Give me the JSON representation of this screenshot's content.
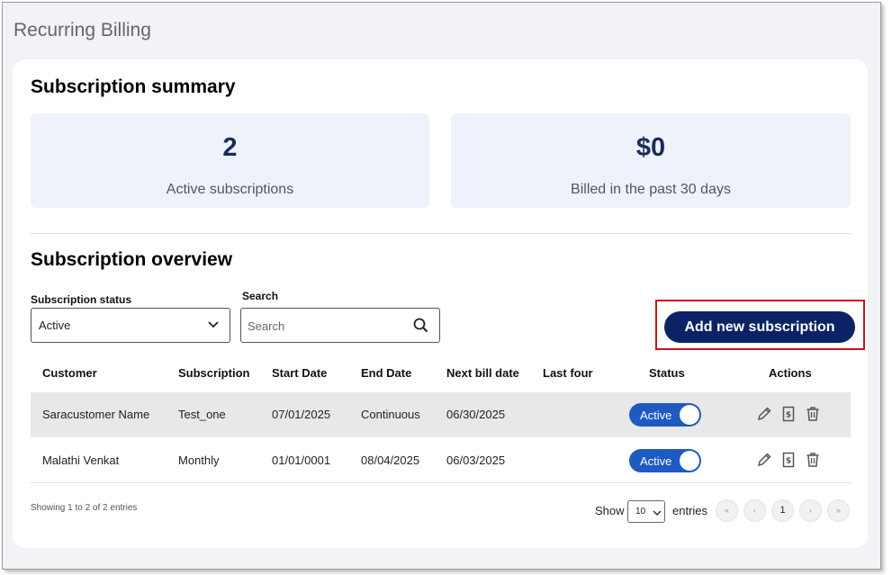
{
  "app": {
    "title": "Recurring Billing"
  },
  "summary": {
    "heading": "Subscription summary",
    "active": {
      "value": "2",
      "label": "Active subscriptions"
    },
    "billed": {
      "value": "$0",
      "label": "Billed in the past 30 days"
    }
  },
  "overview": {
    "heading": "Subscription overview",
    "status_filter": {
      "label": "Subscription status",
      "value": "Active"
    },
    "search": {
      "label": "Search",
      "placeholder": "Search"
    },
    "add_button": "Add new subscription",
    "highlight_color": "#c4161c",
    "accent_color": "#0b2265"
  },
  "table": {
    "headers": {
      "customer": "Customer",
      "subscription": "Subscription",
      "start": "Start Date",
      "end": "End Date",
      "next": "Next bill date",
      "last_four": "Last four",
      "status": "Status",
      "actions": "Actions"
    },
    "rows": [
      {
        "customer": "Saracustomer Name",
        "subscription": "Test_one",
        "start": "07/01/2025",
        "end": "Continuous",
        "next": "06/30/2025",
        "last_four": "",
        "status": "Active",
        "status_on": true
      },
      {
        "customer": "Malathi Venkat",
        "subscription": "Monthly",
        "start": "01/01/0001",
        "end": "08/04/2025",
        "next": "06/03/2025",
        "last_four": "",
        "status": "Active",
        "status_on": true
      }
    ],
    "action_icons": [
      "pencil-icon",
      "bill-icon",
      "trash-icon"
    ]
  },
  "footer": {
    "showing": "Showing 1 to 2 of 2 entries",
    "show_label": "Show",
    "page_size": "10",
    "entries_label": "entries",
    "pager": {
      "first": "«",
      "prev": "‹",
      "current": "1",
      "next": "›",
      "last": "»"
    }
  }
}
